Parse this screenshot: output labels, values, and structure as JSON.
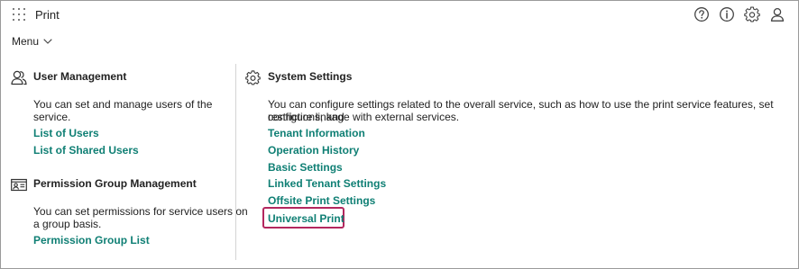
{
  "header": {
    "title": "Print",
    "icons": [
      "apps-icon",
      "help-icon",
      "info-icon",
      "gear-icon",
      "user-icon"
    ]
  },
  "menu": {
    "label": "Menu"
  },
  "user_management": {
    "title": "User Management",
    "description_line1": "You can set and manage users of the",
    "description_line2": "service.",
    "links": [
      "List of Users",
      "List of Shared Users"
    ]
  },
  "permission_group": {
    "title": "Permission Group Management",
    "description_line1": "You can set permissions for service users on",
    "description_line2": "a group basis.",
    "links": [
      "Permission Group List"
    ]
  },
  "system_settings": {
    "title": "System Settings",
    "description_line1": "You can configure settings related to the overall service, such as how to use the print service features, set restrictions, and",
    "description_line2": "configure linkage with external services.",
    "links": [
      "Tenant Information",
      "Operation History",
      "Basic Settings",
      "Linked Tenant Settings",
      "Offsite Print Settings",
      "Universal Print"
    ]
  },
  "colors": {
    "link": "#0f7f74",
    "highlight": "#b3275e"
  }
}
